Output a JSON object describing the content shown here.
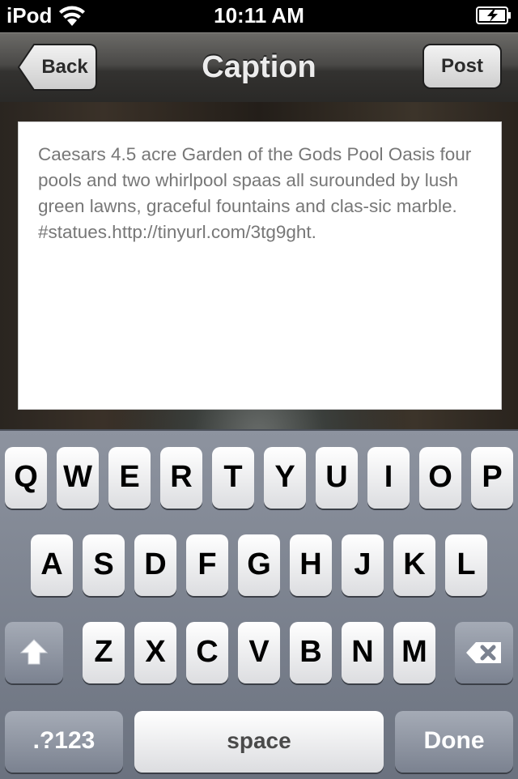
{
  "status": {
    "carrier": "iPod",
    "time": "10:11 AM"
  },
  "nav": {
    "title": "Caption",
    "back_label": "Back",
    "post_label": "Post"
  },
  "caption": {
    "text": "Caesars 4.5 acre Garden of the Gods Pool Oasis four pools and two whirlpool spaas all surounded by lush green lawns, graceful fountains and clas-sic marble. #statues.http://tinyurl.com/3tg9ght."
  },
  "keyboard": {
    "row1": [
      "Q",
      "W",
      "E",
      "R",
      "T",
      "Y",
      "U",
      "I",
      "O",
      "P"
    ],
    "row2": [
      "A",
      "S",
      "D",
      "F",
      "G",
      "H",
      "J",
      "K",
      "L"
    ],
    "row3": [
      "Z",
      "X",
      "C",
      "V",
      "B",
      "N",
      "M"
    ],
    "mode_label": ".?123",
    "space_label": "space",
    "done_label": "Done",
    "shift_icon": "shift-arrow-icon",
    "delete_icon": "backspace-icon"
  },
  "colors": {
    "keyboard_bg": "#7b8290",
    "key_face": "#ffffff",
    "caption_text": "#777777"
  }
}
